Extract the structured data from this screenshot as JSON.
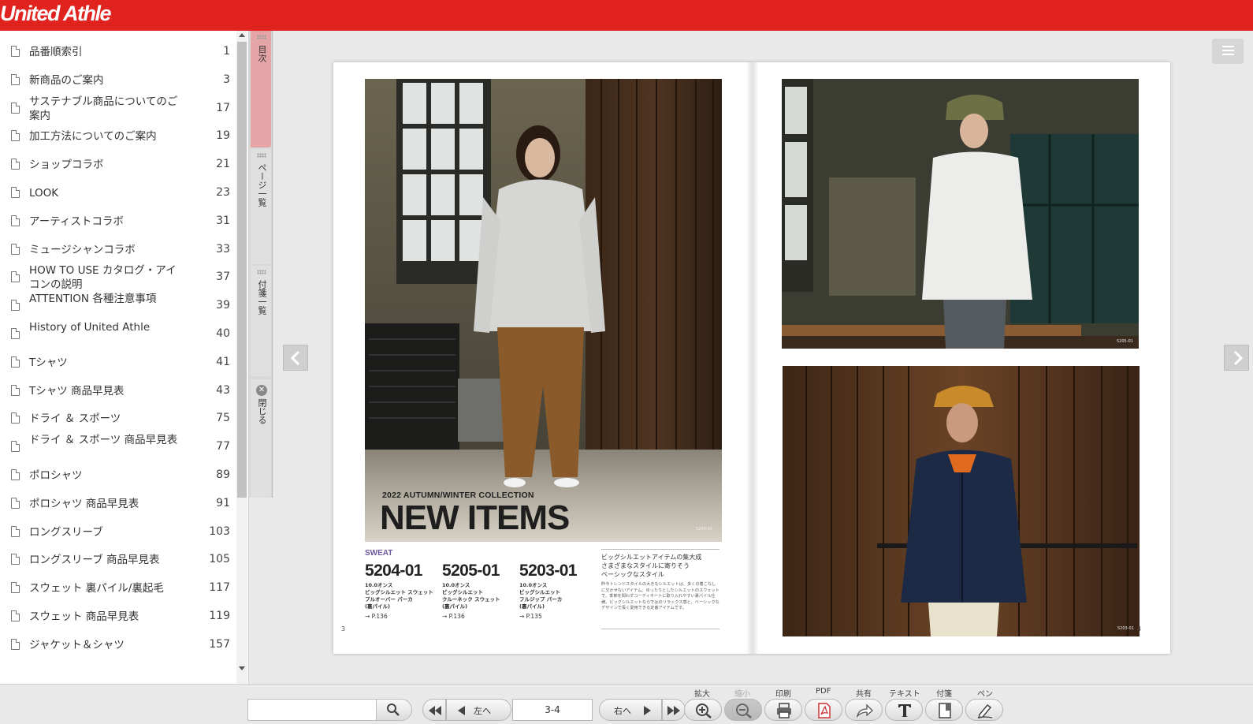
{
  "app": {
    "logo_text": "United Athle"
  },
  "toc": {
    "items": [
      {
        "label": "品番順索引",
        "page": "1"
      },
      {
        "label": "新商品のご案内",
        "page": "3"
      },
      {
        "label": "サステナブル商品についてのご案内",
        "page": "17"
      },
      {
        "label": "加工方法についてのご案内",
        "page": "19"
      },
      {
        "label": "ショップコラボ",
        "page": "21"
      },
      {
        "label": "LOOK",
        "page": "23"
      },
      {
        "label": "アーティストコラボ",
        "page": "31"
      },
      {
        "label": "ミュージシャンコラボ",
        "page": "33"
      },
      {
        "label": "HOW TO USE カタログ・アイコンの説明",
        "page": "37"
      },
      {
        "label": "ATTENTION 各種注意事項",
        "page": "39"
      },
      {
        "label": "History of United Athle",
        "page": "40"
      },
      {
        "label": "Tシャツ",
        "page": "41"
      },
      {
        "label": "Tシャツ 商品早見表",
        "page": "43"
      },
      {
        "label": "ドライ ＆ スポーツ",
        "page": "75"
      },
      {
        "label": "ドライ ＆ スポーツ 商品早見表",
        "page": "77"
      },
      {
        "label": "ポロシャツ",
        "page": "89"
      },
      {
        "label": "ポロシャツ 商品早見表",
        "page": "91"
      },
      {
        "label": "ロングスリーブ",
        "page": "103"
      },
      {
        "label": "ロングスリーブ 商品早見表",
        "page": "105"
      },
      {
        "label": "スウェット 裏パイル/裏起毛",
        "page": "117"
      },
      {
        "label": "スウェット 商品早見表",
        "page": "119"
      },
      {
        "label": "ジャケット＆シャツ",
        "page": "157"
      }
    ]
  },
  "side_tabs": {
    "toc": "目次",
    "pages": "ページ一覧",
    "notes": "付箋一覧",
    "close": "閉じる"
  },
  "left_page": {
    "collection": "2022 AUTUMN/WINTER COLLECTION",
    "headline": "NEW ITEMS",
    "category": "SWEAT",
    "products": [
      {
        "code": "5204-01",
        "desc": [
          "10.0オンス",
          "ビッグシルエット スウェット",
          "プルオーバー パーカ",
          "(裏パイル)"
        ],
        "ref": "→ P.136"
      },
      {
        "code": "5205-01",
        "desc": [
          "10.0オンス",
          "ビッグシルエット",
          "クルーネック スウェット",
          "(裏パイル)"
        ],
        "ref": "→ P.136"
      },
      {
        "code": "5203-01",
        "desc": [
          "10.0オンス",
          "ビッグシルエット",
          "フルジップ パーカ",
          "(裏パイル)"
        ],
        "ref": "→ P.135"
      }
    ],
    "copy_head": [
      "ビッグシルエットアイテムの集大成",
      "さまざまなスタイルに寄りそう",
      "ベーシックなスタイル"
    ],
    "copy_body": "昨今トレンドスタイルの大きなシルエットは、多くの着こなしに欠かせないアイテム。ゆったりとしたシルエットのスウェットで、季節を問わずコーディネートに取り入れやすい裏パイル仕様。ビッグシルエットならではのリラックス感と、ベーシックなデザインで長く愛用できる定番アイテムです。",
    "folio": "3",
    "photo_credit": "5204-01"
  },
  "right_page": {
    "photo_top_credit": "5205-01",
    "photo_bottom_credit": "5203-01",
    "folio": "4"
  },
  "toolbar": {
    "search_placeholder": "",
    "prev_label": "左へ",
    "next_label": "右へ",
    "page_value": "3-4",
    "zoom_in_label": "拡大",
    "zoom_out_label": "縮小",
    "print_label": "印刷",
    "pdf_label": "PDF",
    "share_label": "共有",
    "text_label": "テキスト",
    "sticky_label": "付箋",
    "pen_label": "ペン"
  },
  "colors": {
    "brand": "#e0231e",
    "toc_tab_active": "#e5a5a7",
    "category_accent": "#6a5aa0"
  }
}
